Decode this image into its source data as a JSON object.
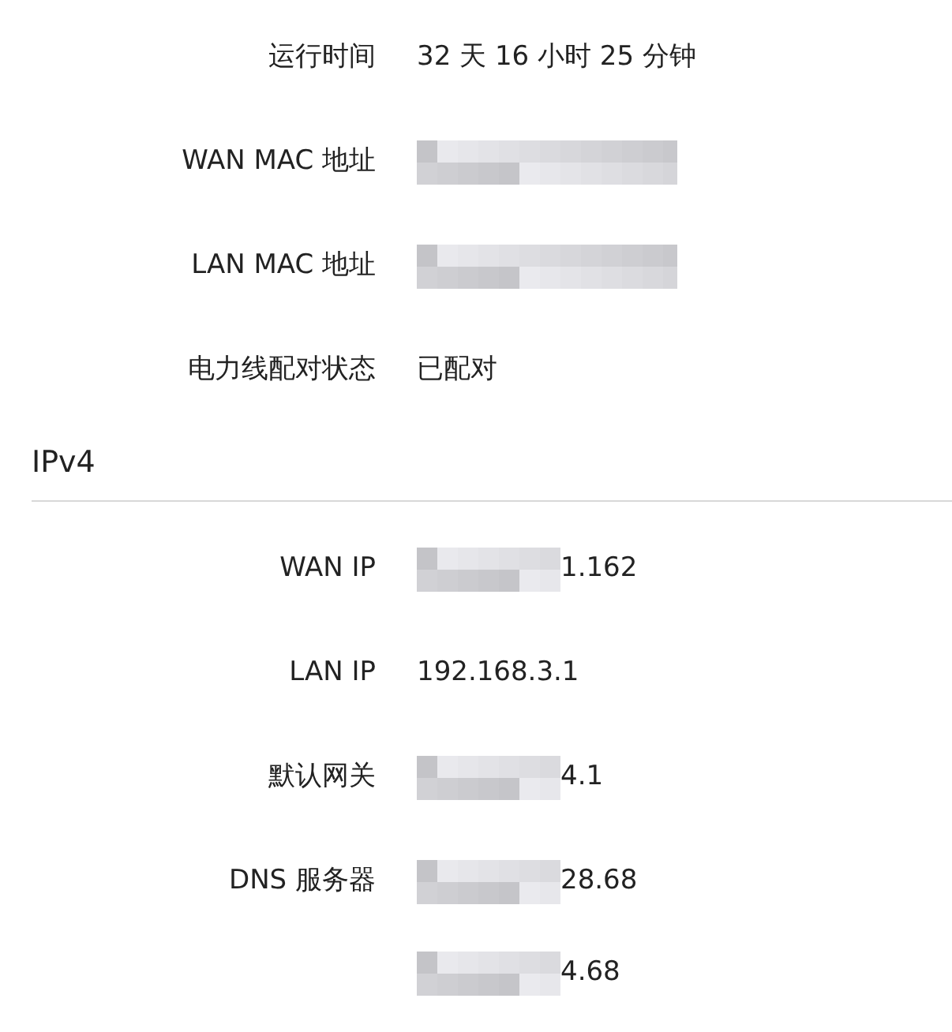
{
  "rows_top": [
    {
      "label": "运行时间",
      "value": "32 天 16 小时 25 分钟",
      "redacted": false
    },
    {
      "label": "WAN MAC 地址",
      "redacted": true
    },
    {
      "label": "LAN MAC 地址",
      "redacted": true
    },
    {
      "label": "电力线配对状态",
      "value": "已配对",
      "redacted": false
    }
  ],
  "section": {
    "title": "IPv4",
    "rows": [
      {
        "label": "WAN IP",
        "value": "1.162",
        "redacted": true
      },
      {
        "label": "LAN IP",
        "value": "192.168.3.1",
        "redacted": false
      },
      {
        "label": "默认网关",
        "value": "4.1",
        "redacted": true
      },
      {
        "label": "DNS 服务器",
        "value": "28.68",
        "redacted": true
      },
      {
        "value": "4.68",
        "redacted": true
      }
    ]
  }
}
